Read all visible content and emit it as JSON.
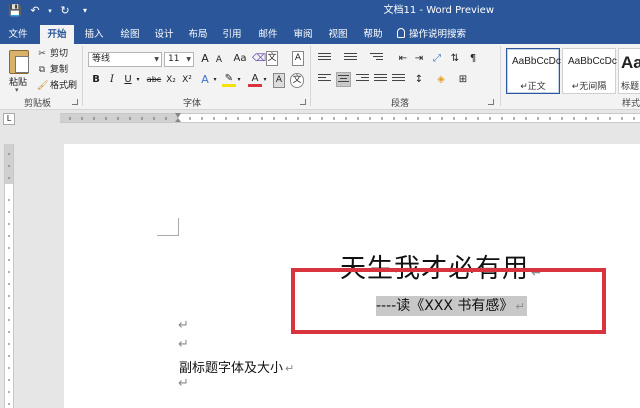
{
  "window": {
    "title": "文档11 - Word Preview"
  },
  "qat": {
    "save_icon": "save-icon",
    "undo_icon": "undo-icon",
    "redo_icon": "redo-icon",
    "customize_icon": "chevron-down-icon"
  },
  "tabs": [
    {
      "label": "文件"
    },
    {
      "label": "开始"
    },
    {
      "label": "插入"
    },
    {
      "label": "绘图"
    },
    {
      "label": "设计"
    },
    {
      "label": "布局"
    },
    {
      "label": "引用"
    },
    {
      "label": "邮件"
    },
    {
      "label": "审阅"
    },
    {
      "label": "视图"
    },
    {
      "label": "帮助"
    },
    {
      "label": "操作说明搜索"
    }
  ],
  "active_tab": "开始",
  "clipboard": {
    "paste": "粘贴",
    "cut": "剪切",
    "copy": "复制",
    "format_painter": "格式刷",
    "group_label": "剪贴板"
  },
  "font": {
    "name": "等线",
    "size": "11",
    "group_label": "字体",
    "grow": "A",
    "shrink": "A",
    "case": "Aa",
    "bold": "B",
    "italic": "I",
    "underline": "U",
    "strike": "abc",
    "sub": "X₂",
    "sup": "X²",
    "wen": "文",
    "color_a": "A",
    "box_a": "A"
  },
  "paragraph": {
    "group_label": "段落"
  },
  "styles": {
    "group_label": "样式",
    "items": [
      {
        "sample": "AaBbCcDc",
        "name": "↵正文"
      },
      {
        "sample": "AaBbCcDc",
        "name": "↵无间隔"
      },
      {
        "sample": "AaB",
        "name": "标题"
      }
    ]
  },
  "document": {
    "title": "天生我才必有用",
    "subtitle": "----读《XXX 书有感》",
    "body_line": "副标题字体及大小",
    "para_mark": "↵"
  },
  "colors": {
    "accent": "#2b579a",
    "highlight": "#d9343e"
  }
}
